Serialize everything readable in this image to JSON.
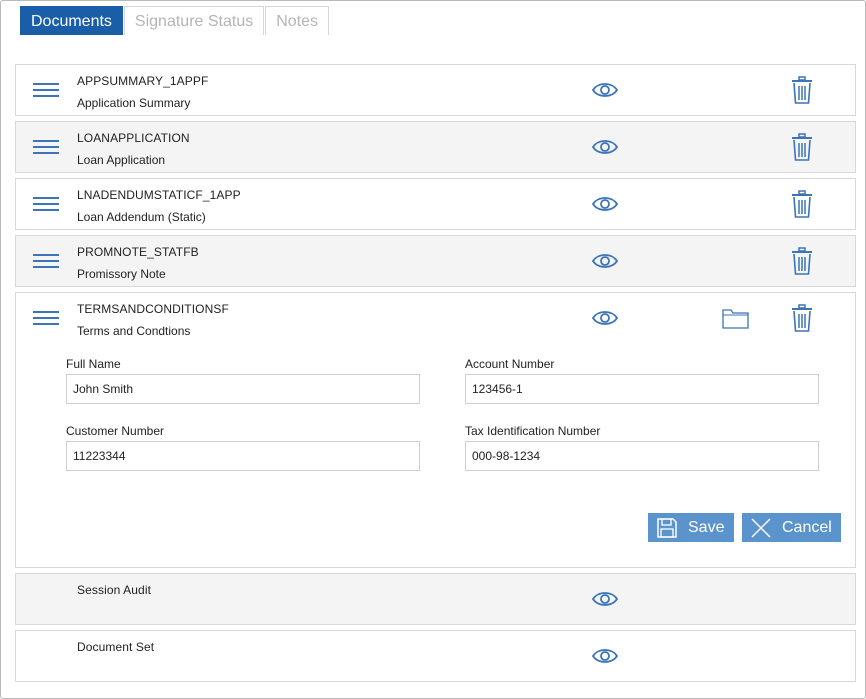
{
  "tabs": [
    {
      "label": "Documents",
      "active": true
    },
    {
      "label": "Signature Status",
      "active": false
    },
    {
      "label": "Notes",
      "active": false
    }
  ],
  "documents": [
    {
      "code": "APPSUMMARY_1APPF",
      "title": "Application Summary"
    },
    {
      "code": "LOANAPPLICATION",
      "title": "Loan Application"
    },
    {
      "code": "LNADENDUMSTATICF_1APP",
      "title": "Loan Addendum (Static)"
    },
    {
      "code": "PROMNOTE_STATFB",
      "title": "Promissory Note"
    },
    {
      "code": "TERMSANDCONDITIONSF",
      "title": "Terms and Condtions"
    }
  ],
  "form": {
    "full_name_label": "Full Name",
    "full_name_value": "John Smith",
    "account_number_label": "Account Number",
    "account_number_value": "123456-1",
    "customer_number_label": "Customer Number",
    "customer_number_value": "11223344",
    "tax_id_label": "Tax Identification Number",
    "tax_id_value": "000-98-1234",
    "save_label": "Save",
    "cancel_label": "Cancel"
  },
  "extra_rows": [
    {
      "title": "Session Audit"
    },
    {
      "title": "Document Set"
    }
  ],
  "colors": {
    "accent": "#1b5ea8",
    "icon": "#3b74b7",
    "button": "#5b94cd"
  }
}
